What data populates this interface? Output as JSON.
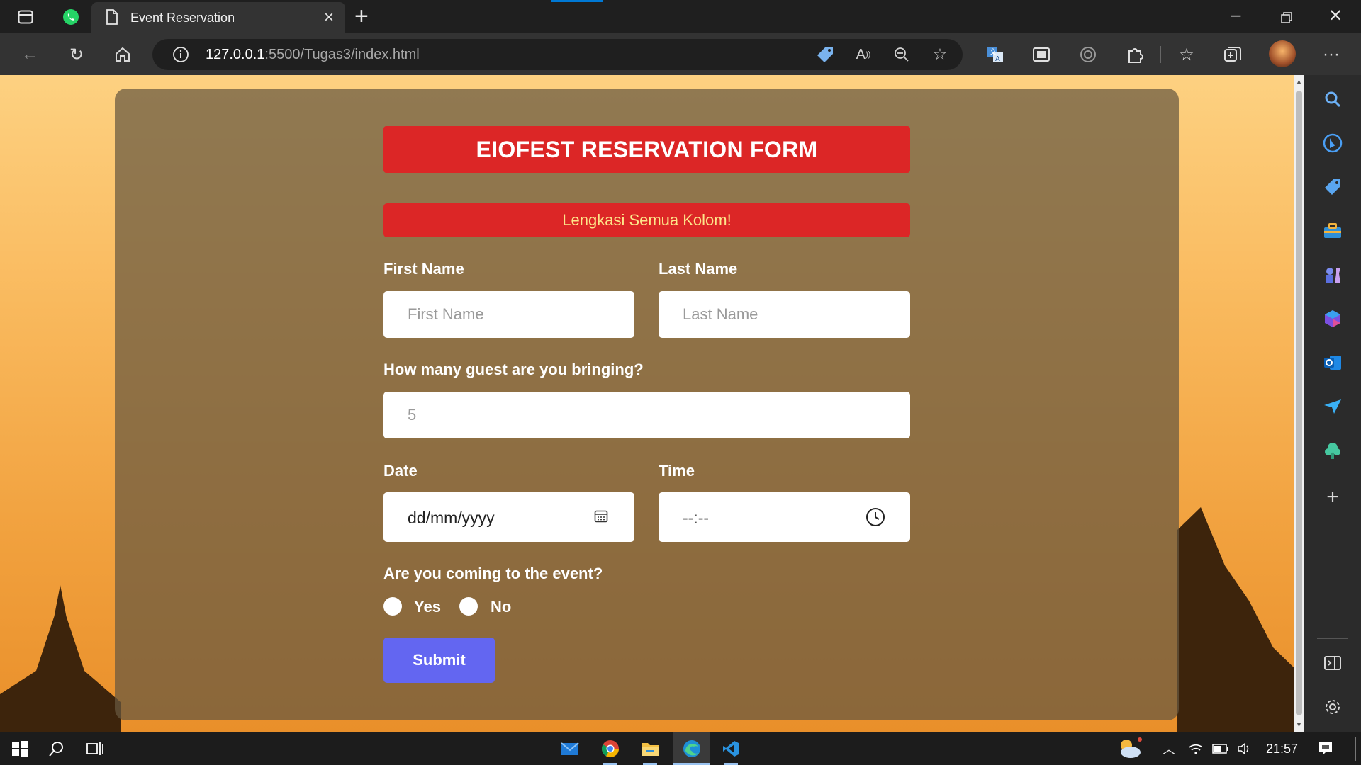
{
  "browser": {
    "tab_title": "Event Reservation",
    "url_host": "127.0.0.1",
    "url_rest": ":5500/Tugas3/index.html"
  },
  "form": {
    "title": "EIOFEST RESERVATION FORM",
    "alert": "Lengkasi Semua Kolom!",
    "first_name_label": "First Name",
    "first_name_placeholder": "First Name",
    "last_name_label": "Last Name",
    "last_name_placeholder": "Last Name",
    "guests_label": "How many guest are you bringing?",
    "guests_placeholder": "5",
    "date_label": "Date",
    "date_placeholder": "dd/mm/yyyy",
    "time_label": "Time",
    "time_placeholder": "--:--",
    "attend_label": "Are you coming to the event?",
    "option_yes": "Yes",
    "option_no": "No",
    "submit_label": "Submit"
  },
  "taskbar": {
    "clock": "21:57"
  },
  "colors": {
    "header_red": "#dc2626",
    "alert_text": "#fde68a",
    "submit_indigo": "#6366f1"
  }
}
